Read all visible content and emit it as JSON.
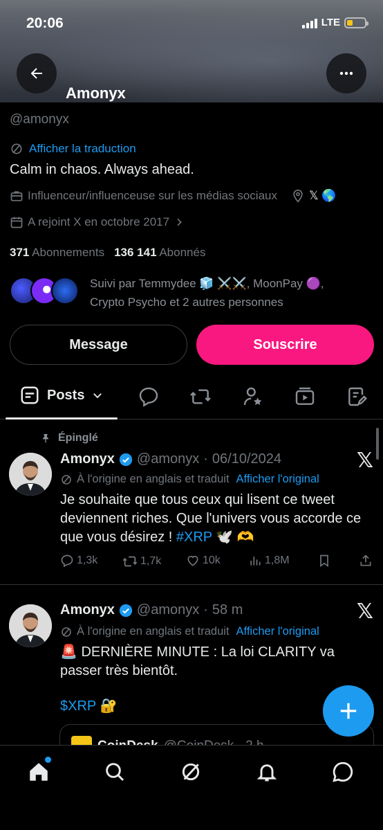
{
  "status_bar": {
    "time": "20:06",
    "network": "LTE"
  },
  "header": {
    "title": "Amonyx"
  },
  "profile": {
    "handle": "@amonyx",
    "translate_link": "Afficher la traduction",
    "bio": "Calm in chaos. Always ahead.",
    "category": "Influenceur/influenceuse sur les médias sociaux",
    "location_emojis": "𝕏 🌎",
    "joined": "A rejoint X en octobre 2017",
    "following_count": "371",
    "following_label": "Abonnements",
    "followers_count": "136 141",
    "followers_label": "Abonnés",
    "followed_by": "Suivi par Temmydee 🧊 ⚔️⚔️, MoonPay 🟣, Crypto Psycho et 2 autres personnes"
  },
  "buttons": {
    "message": "Message",
    "subscribe": "Souscrire"
  },
  "tabs": {
    "posts": "Posts"
  },
  "posts": [
    {
      "pinned_label": "Épinglé",
      "name": "Amonyx",
      "handle": "@amonyx",
      "sep": "·",
      "date": "06/10/2024",
      "translated_note": "À l'origine en anglais et traduit",
      "show_original": "Afficher l'original",
      "text": "Je souhaite que tous ceux qui lisent ce tweet deviennent riches. Que l'univers vous accorde ce que vous désirez ! ",
      "hashtag": "#XRP",
      "emoji_tail": " 🕊️ 🫶",
      "replies": "1,3k",
      "reposts": "1,7k",
      "likes": "10k",
      "views": "1,8M"
    },
    {
      "name": "Amonyx",
      "handle": "@amonyx",
      "sep": "·",
      "date": "58 m",
      "translated_note": "À l'origine en anglais et traduit",
      "show_original": "Afficher l'original",
      "text_line1": "🚨 DERNIÈRE MINUTE : La loi CLARITY va passer très bientôt.",
      "cashtag": "$XRP",
      "emoji_tail": " 🔐",
      "quote_name": "CoinDesk",
      "quote_handle": "@CoinDesk · 2 h"
    }
  ],
  "colors": {
    "accent": "#1d9bf0",
    "subscribe": "#f91880",
    "background": "#000000"
  }
}
